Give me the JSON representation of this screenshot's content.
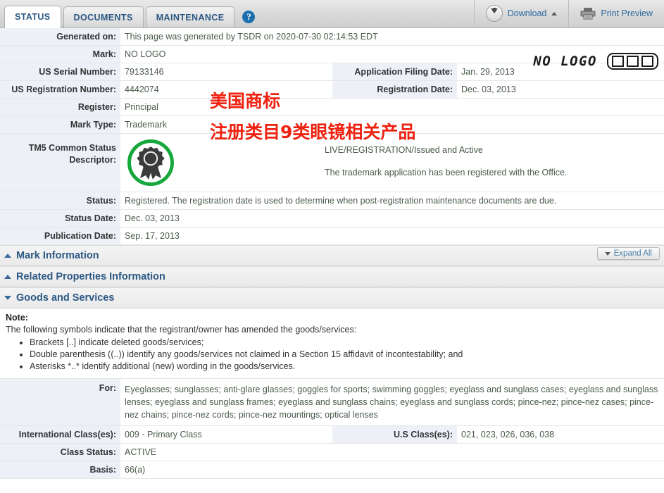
{
  "tabs": [
    {
      "label": "STATUS",
      "active": true
    },
    {
      "label": "DOCUMENTS",
      "active": false
    },
    {
      "label": "MAINTENANCE",
      "active": false
    }
  ],
  "help_label": "?",
  "toolbar": {
    "download_label": "Download",
    "print_preview_label": "Print Preview"
  },
  "mark_display": {
    "no_logo_text": "NO LOGO",
    "logo_box": "OOO"
  },
  "fields": {
    "generated_on_label": "Generated on:",
    "generated_on_value": "This page was generated by TSDR on 2020-07-30 02:14:53 EDT",
    "mark_label": "Mark:",
    "mark_value": "NO LOGO",
    "us_serial_label": "US Serial Number:",
    "us_serial_value": "79133146",
    "application_filing_label": "Application Filing Date:",
    "application_filing_value": "Jan. 29, 2013",
    "us_registration_label": "US Registration Number:",
    "us_registration_value": "4442074",
    "registration_date_label": "Registration Date:",
    "registration_date_value": "Dec. 03, 2013",
    "register_label": "Register:",
    "register_value": "Principal",
    "mark_type_label": "Mark Type:",
    "mark_type_value": "Trademark",
    "tm5_label_line1": "TM5 Common Status",
    "tm5_label_line2": "Descriptor:",
    "tm5_status_line": "LIVE/REGISTRATION/Issued and Active",
    "tm5_status_desc": "The trademark application has been registered with the Office.",
    "status_label": "Status:",
    "status_value": "Registered. The registration date is used to determine when post-registration maintenance documents are due.",
    "status_date_label": "Status Date:",
    "status_date_value": "Dec. 03, 2013",
    "publication_date_label": "Publication Date:",
    "publication_date_value": "Sep. 17, 2013"
  },
  "sections": {
    "mark_information": "Mark Information",
    "related_properties": "Related Properties Information",
    "goods_and_services": "Goods and Services",
    "expand_all": "Expand All"
  },
  "note": {
    "title": "Note:",
    "intro": "The following symbols indicate that the registrant/owner has amended the goods/services:",
    "bullets": [
      "Brackets [..] indicate deleted goods/services;",
      "Double parenthesis ((..)) identify any goods/services not claimed in a Section 15 affidavit of incontestability; and",
      "Asterisks *..* identify additional (new) wording in the goods/services."
    ]
  },
  "goods": {
    "for_label": "For:",
    "for_value": "Eyeglasses; sunglasses; anti-glare glasses; goggles for sports; swimming goggles; eyeglass and sunglass cases; eyeglass and sunglass lenses; eyeglass and sunglass frames; eyeglass and sunglass chains; eyeglass and sunglass cords; pince-nez; pince-nez cases; pince-nez chains; pince-nez cords; pince-nez mountings; optical lenses",
    "international_class_label": "International Class(es):",
    "international_class_value": "009 - Primary Class",
    "us_class_label": "U.S Class(es):",
    "us_class_value": "021, 023, 026, 036, 038",
    "class_status_label": "Class Status:",
    "class_status_value": "ACTIVE",
    "basis_label": "Basis:",
    "basis_value": "66(a)"
  },
  "annotations": {
    "line1": "美国商标",
    "line2": "注册类目9类眼镜相关产品",
    "color": "#ee2211"
  },
  "colors": {
    "tab_text": "#2b5884",
    "label_bg": "#eef0f8",
    "section_text": "#2b5884",
    "seal_green": "#16a83c",
    "link_blue": "#2b6a9e"
  }
}
